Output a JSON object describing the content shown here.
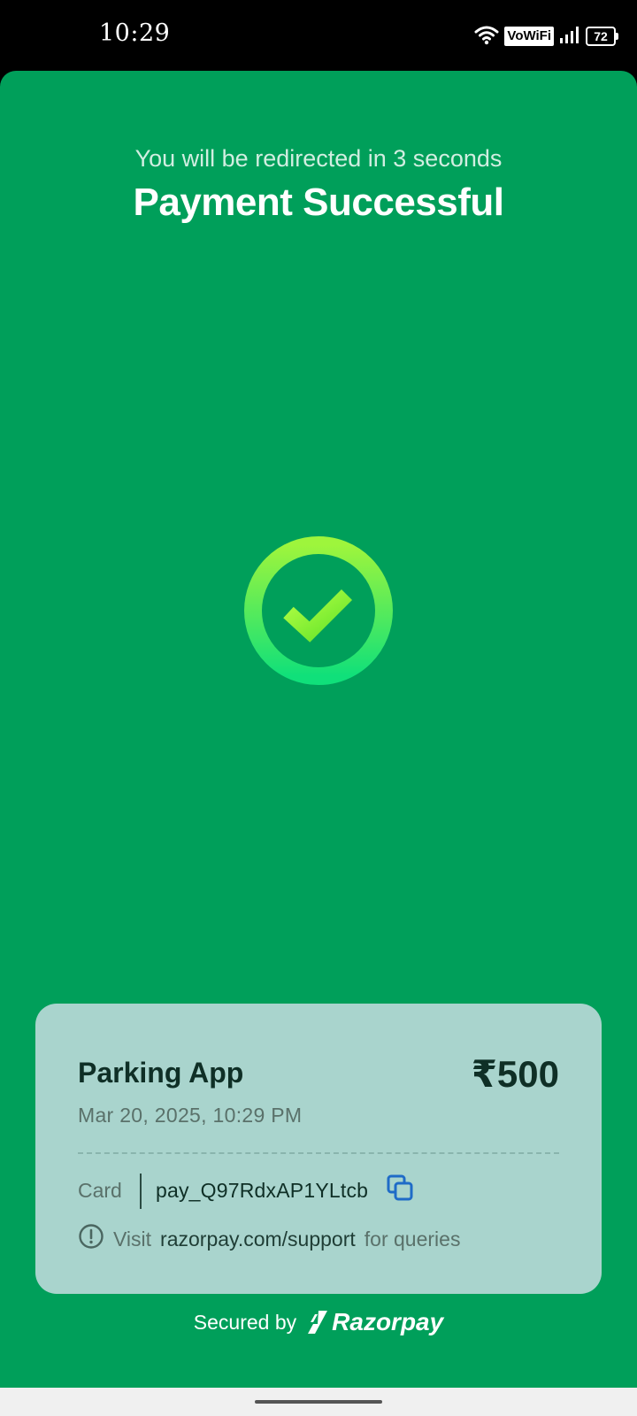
{
  "status_bar": {
    "time": "10:29",
    "network_badge": "VoWiFi",
    "battery_level": "72",
    "icons": [
      "wifi-icon",
      "signal-icon",
      "battery-icon"
    ]
  },
  "payment": {
    "redirect_message": "You will be redirected in 3 seconds",
    "title": "Payment Successful",
    "status_icon": "success-check-icon"
  },
  "details": {
    "merchant": "Parking App",
    "amount": "₹500",
    "datetime": "Mar 20, 2025, 10:29 PM",
    "method": "Card",
    "payment_id": "pay_Q97RdxAP1YLtcb",
    "support_prefix": "Visit",
    "support_link": "razorpay.com/support",
    "support_suffix": "for queries"
  },
  "footer": {
    "secured_by": "Secured by",
    "brand": "Razorpay"
  },
  "colors": {
    "panel_background": "#009f5a",
    "card_background": "#a9d4cd",
    "copy_icon": "#1f6bc7",
    "check_green": "#9ef53c"
  }
}
